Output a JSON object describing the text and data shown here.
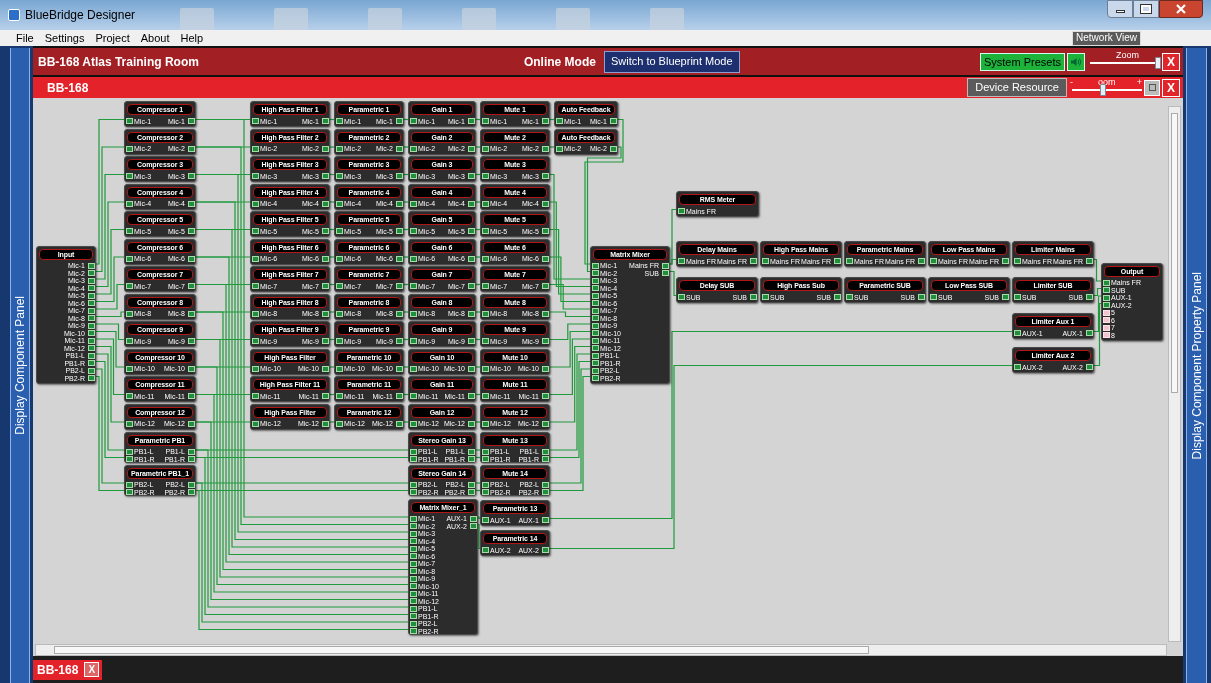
{
  "window": {
    "title": "BlueBridge Designer"
  },
  "menu": [
    "File",
    "Settings",
    "Project",
    "About",
    "Help"
  ],
  "network_view_button": "Network View",
  "side_panels": {
    "left": "Display Component Panel",
    "right": "Display Component Property Panel"
  },
  "header": {
    "title": "BB-168 Atlas Training Room",
    "mode": "Online Mode",
    "switch_button": "Switch to Blueprint Mode",
    "presets_button": "System Presets",
    "zoom": {
      "label": "Zoom",
      "level": 0.95
    },
    "close": "X"
  },
  "device_bar": {
    "title": "BB-168",
    "resource_button": "Device Resource",
    "zoom": {
      "label": "oom",
      "minus": "-",
      "plus": "+",
      "level": 0.45
    },
    "close": "X"
  },
  "diagram": {
    "nodes": [
      {
        "title": "Input",
        "outputs": [
          "Mic-1",
          "Mic-2",
          "Mic-3",
          "Mic-4",
          "Mic-5",
          "Mic-6",
          "Mic-7",
          "Mic-8",
          "Mic-9",
          "Mic-10",
          "Mic-11",
          "Mic-12",
          "PB1-L",
          "PB1-R",
          "PB2-L",
          "PB2-R"
        ]
      },
      {
        "title": "Compressor 1",
        "inputs": [
          "Mic-1"
        ],
        "outputs": [
          "Mic-1"
        ]
      },
      {
        "title": "Compressor 2",
        "inputs": [
          "Mic-2"
        ],
        "outputs": [
          "Mic-2"
        ]
      },
      {
        "title": "Compressor 3",
        "inputs": [
          "Mic-3"
        ],
        "outputs": [
          "Mic-3"
        ]
      },
      {
        "title": "Compressor 4",
        "inputs": [
          "Mic-4"
        ],
        "outputs": [
          "Mic-4"
        ]
      },
      {
        "title": "Compressor 5",
        "inputs": [
          "Mic-5"
        ],
        "outputs": [
          "Mic-5"
        ]
      },
      {
        "title": "Compressor 6",
        "inputs": [
          "Mic-6"
        ],
        "outputs": [
          "Mic-6"
        ]
      },
      {
        "title": "Compressor 7",
        "inputs": [
          "Mic-7"
        ],
        "outputs": [
          "Mic-7"
        ]
      },
      {
        "title": "Compressor 8",
        "inputs": [
          "Mic-8"
        ],
        "outputs": [
          "Mic-8"
        ]
      },
      {
        "title": "Compressor 9",
        "inputs": [
          "Mic-9"
        ],
        "outputs": [
          "Mic-9"
        ]
      },
      {
        "title": "Compressor 10",
        "inputs": [
          "Mic-10"
        ],
        "outputs": [
          "Mic-10"
        ]
      },
      {
        "title": "Compressor 11",
        "inputs": [
          "Mic-11"
        ],
        "outputs": [
          "Mic-11"
        ]
      },
      {
        "title": "Compressor 12",
        "inputs": [
          "Mic-12"
        ],
        "outputs": [
          "Mic-12"
        ]
      },
      {
        "title": "Parametric PB1",
        "inputs": [
          "PB1-L",
          "PB1-R"
        ],
        "outputs": [
          "PB1-L",
          "PB1-R"
        ]
      },
      {
        "title": "Parametric PB1_1",
        "inputs": [
          "PB2-L",
          "PB2-R"
        ],
        "outputs": [
          "PB2-L",
          "PB2-R"
        ]
      },
      {
        "title": "High Pass Filter 1",
        "inputs": [
          "Mic-1"
        ],
        "outputs": [
          "Mic-1"
        ]
      },
      {
        "title": "High Pass Filter 2",
        "inputs": [
          "Mic-2"
        ],
        "outputs": [
          "Mic-2"
        ]
      },
      {
        "title": "High Pass Filter 3",
        "inputs": [
          "Mic-3"
        ],
        "outputs": [
          "Mic-3"
        ]
      },
      {
        "title": "High Pass Filter 4",
        "inputs": [
          "Mic-4"
        ],
        "outputs": [
          "Mic-4"
        ]
      },
      {
        "title": "High Pass Filter 5",
        "inputs": [
          "Mic-5"
        ],
        "outputs": [
          "Mic-5"
        ]
      },
      {
        "title": "High Pass Filter 6",
        "inputs": [
          "Mic-6"
        ],
        "outputs": [
          "Mic-6"
        ]
      },
      {
        "title": "High Pass Filter 7",
        "inputs": [
          "Mic-7"
        ],
        "outputs": [
          "Mic-7"
        ]
      },
      {
        "title": "High Pass Filter 8",
        "inputs": [
          "Mic-8"
        ],
        "outputs": [
          "Mic-8"
        ]
      },
      {
        "title": "High Pass Filter 9",
        "inputs": [
          "Mic-9"
        ],
        "outputs": [
          "Mic-9"
        ]
      },
      {
        "title": "High Pass Filter",
        "inputs": [
          "Mic-10"
        ],
        "outputs": [
          "Mic-10"
        ]
      },
      {
        "title": "High Pass Filter 11",
        "inputs": [
          "Mic-11"
        ],
        "outputs": [
          "Mic-11"
        ]
      },
      {
        "title": "High Pass Filter",
        "inputs": [
          "Mic-12"
        ],
        "outputs": [
          "Mic-12"
        ]
      },
      {
        "title": "Parametric 1",
        "inputs": [
          "Mic-1"
        ],
        "outputs": [
          "Mic-1"
        ]
      },
      {
        "title": "Parametric 2",
        "inputs": [
          "Mic-2"
        ],
        "outputs": [
          "Mic-2"
        ]
      },
      {
        "title": "Parametric 3",
        "inputs": [
          "Mic-3"
        ],
        "outputs": [
          "Mic-3"
        ]
      },
      {
        "title": "Parametric 4",
        "inputs": [
          "Mic-4"
        ],
        "outputs": [
          "Mic-4"
        ]
      },
      {
        "title": "Parametric 5",
        "inputs": [
          "Mic-5"
        ],
        "outputs": [
          "Mic-5"
        ]
      },
      {
        "title": "Parametric 6",
        "inputs": [
          "Mic-6"
        ],
        "outputs": [
          "Mic-6"
        ]
      },
      {
        "title": "Parametric 7",
        "inputs": [
          "Mic-7"
        ],
        "outputs": [
          "Mic-7"
        ]
      },
      {
        "title": "Parametric 8",
        "inputs": [
          "Mic-8"
        ],
        "outputs": [
          "Mic-8"
        ]
      },
      {
        "title": "Parametric 9",
        "inputs": [
          "Mic-9"
        ],
        "outputs": [
          "Mic-9"
        ]
      },
      {
        "title": "Parametric 10",
        "inputs": [
          "Mic-10"
        ],
        "outputs": [
          "Mic-10"
        ]
      },
      {
        "title": "Parametric 11",
        "inputs": [
          "Mic-11"
        ],
        "outputs": [
          "Mic-11"
        ]
      },
      {
        "title": "Parametric 12",
        "inputs": [
          "Mic-12"
        ],
        "outputs": [
          "Mic-12"
        ]
      },
      {
        "title": "Gain 1",
        "inputs": [
          "Mic-1"
        ],
        "outputs": [
          "Mic-1"
        ]
      },
      {
        "title": "Gain 2",
        "inputs": [
          "Mic-2"
        ],
        "outputs": [
          "Mic-2"
        ]
      },
      {
        "title": "Gain 3",
        "inputs": [
          "Mic-3"
        ],
        "outputs": [
          "Mic-3"
        ]
      },
      {
        "title": "Gain 4",
        "inputs": [
          "Mic-4"
        ],
        "outputs": [
          "Mic-4"
        ]
      },
      {
        "title": "Gain 5",
        "inputs": [
          "Mic-5"
        ],
        "outputs": [
          "Mic-5"
        ]
      },
      {
        "title": "Gain 6",
        "inputs": [
          "Mic-6"
        ],
        "outputs": [
          "Mic-6"
        ]
      },
      {
        "title": "Gain 7",
        "inputs": [
          "Mic-7"
        ],
        "outputs": [
          "Mic-7"
        ]
      },
      {
        "title": "Gain 8",
        "inputs": [
          "Mic-8"
        ],
        "outputs": [
          "Mic-8"
        ]
      },
      {
        "title": "Gain 9",
        "inputs": [
          "Mic-9"
        ],
        "outputs": [
          "Mic-9"
        ]
      },
      {
        "title": "Gain 10",
        "inputs": [
          "Mic-10"
        ],
        "outputs": [
          "Mic-10"
        ]
      },
      {
        "title": "Gain 11",
        "inputs": [
          "Mic-11"
        ],
        "outputs": [
          "Mic-11"
        ]
      },
      {
        "title": "Gain 12",
        "inputs": [
          "Mic-12"
        ],
        "outputs": [
          "Mic-12"
        ]
      },
      {
        "title": "Stereo Gain 13",
        "inputs": [
          "PB1-L",
          "PB1-R"
        ],
        "outputs": [
          "PB1-L",
          "PB1-R"
        ]
      },
      {
        "title": "Stereo Gain 14",
        "inputs": [
          "PB2-L",
          "PB2-R"
        ],
        "outputs": [
          "PB2-L",
          "PB2-R"
        ]
      },
      {
        "title": "Mute 1",
        "inputs": [
          "Mic-1"
        ],
        "outputs": [
          "Mic-1"
        ]
      },
      {
        "title": "Mute 2",
        "inputs": [
          "Mic-2"
        ],
        "outputs": [
          "Mic-2"
        ]
      },
      {
        "title": "Mute 3",
        "inputs": [
          "Mic-3"
        ],
        "outputs": [
          "Mic-3"
        ]
      },
      {
        "title": "Mute 4",
        "inputs": [
          "Mic-4"
        ],
        "outputs": [
          "Mic-4"
        ]
      },
      {
        "title": "Mute 5",
        "inputs": [
          "Mic-5"
        ],
        "outputs": [
          "Mic-5"
        ]
      },
      {
        "title": "Mute 6",
        "inputs": [
          "Mic-6"
        ],
        "outputs": [
          "Mic-6"
        ]
      },
      {
        "title": "Mute 7",
        "inputs": [
          "Mic-7"
        ],
        "outputs": [
          "Mic-7"
        ]
      },
      {
        "title": "Mute 8",
        "inputs": [
          "Mic-8"
        ],
        "outputs": [
          "Mic-8"
        ]
      },
      {
        "title": "Mute 9",
        "inputs": [
          "Mic-9"
        ],
        "outputs": [
          "Mic-9"
        ]
      },
      {
        "title": "Mute 10",
        "inputs": [
          "Mic-10"
        ],
        "outputs": [
          "Mic-10"
        ]
      },
      {
        "title": "Mute 11",
        "inputs": [
          "Mic-11"
        ],
        "outputs": [
          "Mic-11"
        ]
      },
      {
        "title": "Mute 12",
        "inputs": [
          "Mic-12"
        ],
        "outputs": [
          "Mic-12"
        ]
      },
      {
        "title": "Mute 13",
        "inputs": [
          "PB1-L",
          "PB1-R"
        ],
        "outputs": [
          "PB1-L",
          "PB1-R"
        ]
      },
      {
        "title": "Mute 14",
        "inputs": [
          "PB2-L",
          "PB2-R"
        ],
        "outputs": [
          "PB2-L",
          "PB2-R"
        ]
      },
      {
        "title": "Auto Feedback",
        "inputs": [
          "Mic-1"
        ],
        "outputs": [
          "Mic-1"
        ]
      },
      {
        "title": "Auto Feedback",
        "inputs": [
          "Mic-2"
        ],
        "outputs": [
          "Mic-2"
        ]
      },
      {
        "title": "Matrix Mixer",
        "inputs": [
          "Mic-1",
          "Mic-2",
          "Mic-3",
          "Mic-4",
          "Mic-5",
          "Mic-6",
          "Mic-7",
          "Mic-8",
          "Mic-9",
          "Mic-10",
          "Mic-11",
          "Mic-12",
          "PB1-L",
          "PB1-R",
          "PB2-L",
          "PB2-R"
        ],
        "outputs": [
          "Mains FR",
          "SUB"
        ]
      },
      {
        "title": "Matrix Mixer_1",
        "inputs": [
          "Mic-1",
          "Mic-2",
          "Mic-3",
          "Mic-4",
          "Mic-5",
          "Mic-6",
          "Mic-7",
          "Mic-8",
          "Mic-9",
          "Mic-10",
          "Mic-11",
          "Mic-12",
          "PB1-L",
          "PB1-R",
          "PB2-L",
          "PB2-R"
        ],
        "outputs": [
          "AUX-1",
          "AUX-2"
        ]
      },
      {
        "title": "Parametric 13",
        "inputs": [
          "AUX-1"
        ],
        "outputs": [
          "AUX-1"
        ]
      },
      {
        "title": "Parametric 14",
        "inputs": [
          "AUX-2"
        ],
        "outputs": [
          "AUX-2"
        ]
      },
      {
        "title": "RMS Meter",
        "inputs": [
          "Mains FR"
        ]
      },
      {
        "title": "Delay Mains",
        "inputs": [
          "Mains FR"
        ],
        "outputs": [
          "Mains FR"
        ]
      },
      {
        "title": "High Pass Mains",
        "inputs": [
          "Mains FR"
        ],
        "outputs": [
          "Mains FR"
        ]
      },
      {
        "title": "Parametric Mains",
        "inputs": [
          "Mains FR"
        ],
        "outputs": [
          "Mains FR"
        ]
      },
      {
        "title": "Low Pass Mains",
        "inputs": [
          "Mains FR"
        ],
        "outputs": [
          "Mains FR"
        ]
      },
      {
        "title": "Limiter Mains",
        "inputs": [
          "Mains FR"
        ],
        "outputs": [
          "Mains FR"
        ]
      },
      {
        "title": "Delay SUB",
        "inputs": [
          "SUB"
        ],
        "outputs": [
          "SUB"
        ]
      },
      {
        "title": "High Pass Sub",
        "inputs": [
          "SUB"
        ],
        "outputs": [
          "SUB"
        ]
      },
      {
        "title": "Parametric SUB",
        "inputs": [
          "SUB"
        ],
        "outputs": [
          "SUB"
        ]
      },
      {
        "title": "Low Pass SUB",
        "inputs": [
          "SUB"
        ],
        "outputs": [
          "SUB"
        ]
      },
      {
        "title": "Limiter SUB",
        "inputs": [
          "SUB"
        ],
        "outputs": [
          "SUB"
        ]
      },
      {
        "title": "Limiter Aux 1",
        "inputs": [
          "AUX-1"
        ],
        "outputs": [
          "AUX-1"
        ]
      },
      {
        "title": "Limiter Aux 2",
        "inputs": [
          "AUX-2"
        ],
        "outputs": [
          "AUX-2"
        ]
      },
      {
        "title": "Output",
        "inputs": [
          "Mains FR",
          "SUB",
          "AUX-1",
          "AUX-2"
        ],
        "unconnected_inputs": [
          "5",
          "6",
          "7",
          "8"
        ]
      }
    ]
  },
  "bottom_tabs": [
    {
      "label": "BB-168",
      "close": "X",
      "selected": true
    }
  ]
}
